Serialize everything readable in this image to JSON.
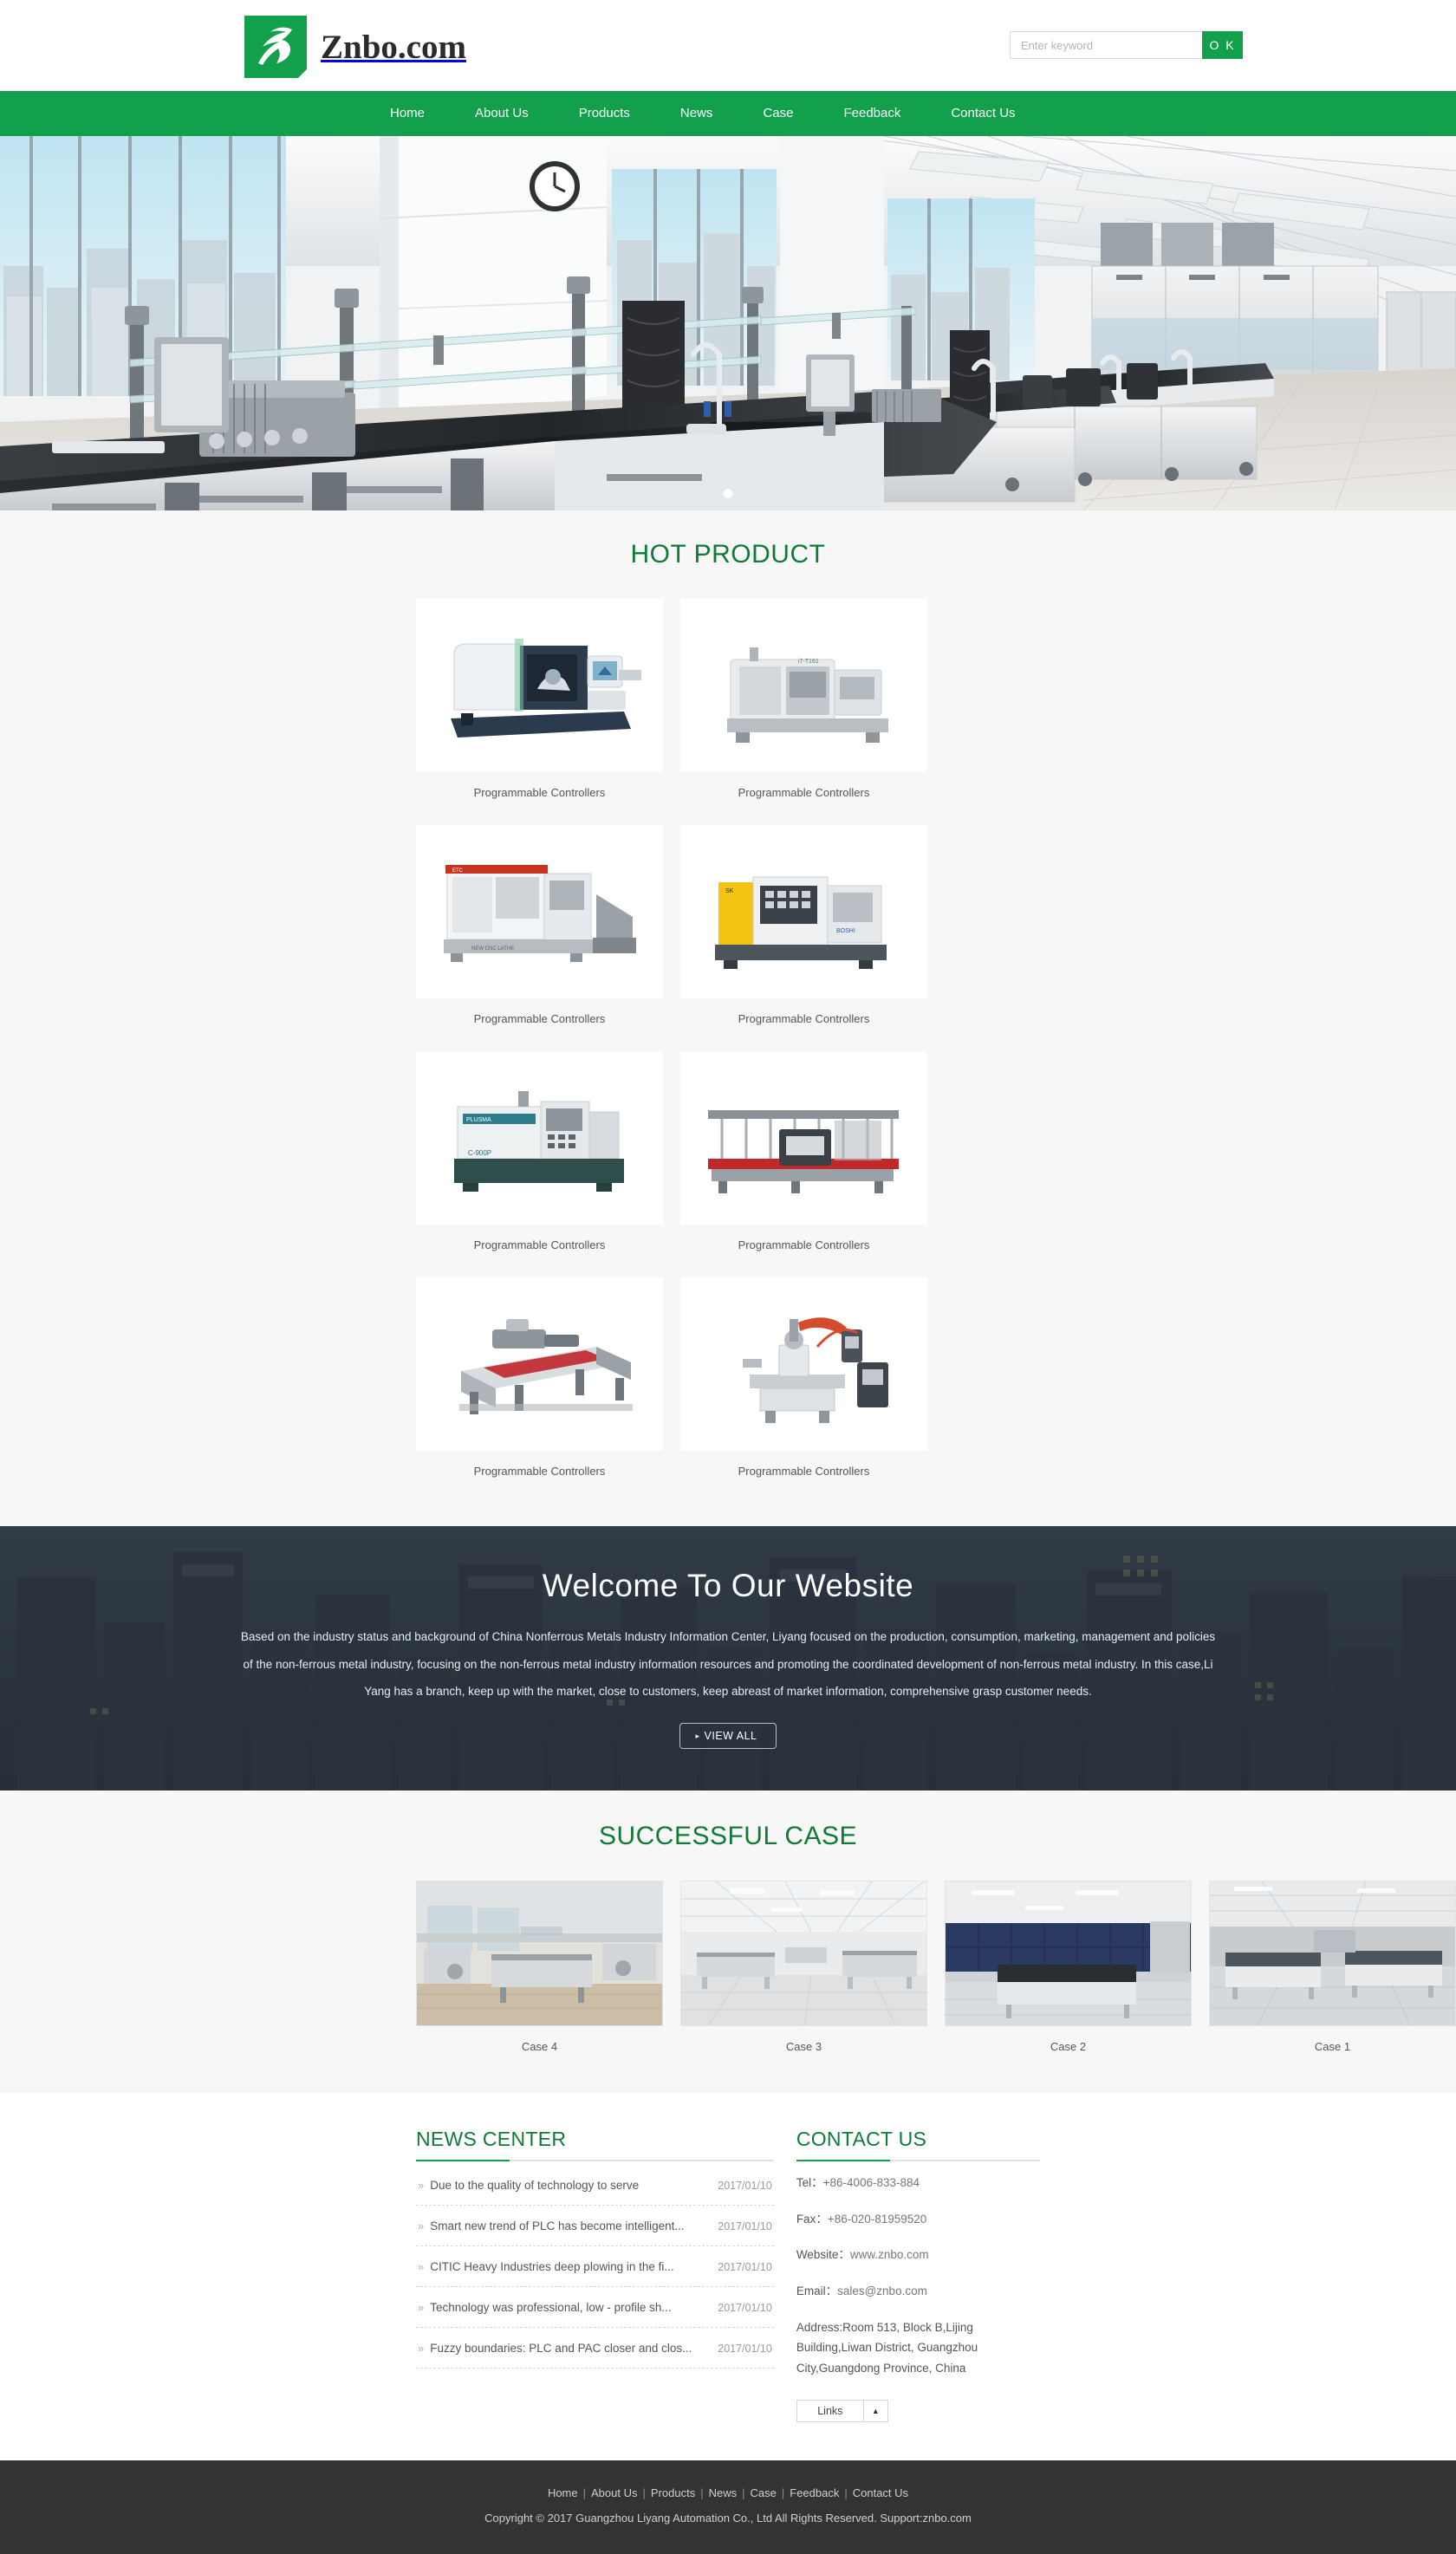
{
  "header": {
    "logo_text": "Znbo.com",
    "logo_icon": "znbo-bird-logo-icon",
    "search": {
      "placeholder": "Enter keyword",
      "value": "",
      "button_label": "O K"
    }
  },
  "nav": {
    "items": [
      {
        "label": "Home"
      },
      {
        "label": "About Us"
      },
      {
        "label": "Products"
      },
      {
        "label": "News"
      },
      {
        "label": "Case"
      },
      {
        "label": "Feedback"
      },
      {
        "label": "Contact Us"
      }
    ]
  },
  "hero": {
    "alt": "laboratory interior with white benches and black countertops",
    "slide_count": 1
  },
  "hot_product": {
    "title": "HOT PRODUCT",
    "items": [
      {
        "label": "Programmable Controllers",
        "image": "cnc-lathe-dark-blue"
      },
      {
        "label": "Programmable Controllers",
        "image": "cnc-milling-grey"
      },
      {
        "label": "Programmable Controllers",
        "image": "cnc-lathe-etc-white"
      },
      {
        "label": "Programmable Controllers",
        "image": "cnc-lathe-yellow-skg"
      },
      {
        "label": "Programmable Controllers",
        "image": "cnc-lathe-teal-c900p"
      },
      {
        "label": "Programmable Controllers",
        "image": "glass-edging-machine"
      },
      {
        "label": "Programmable Controllers",
        "image": "glass-cutting-table"
      },
      {
        "label": "Programmable Controllers",
        "image": "robotic-arm-machine"
      }
    ]
  },
  "welcome": {
    "title": "Welcome To Our Website",
    "body": "Based on the industry status and background of China Nonferrous Metals Industry Information Center, Liyang focused on the production, consumption, marketing, management and policies of the non-ferrous metal industry, focusing on the non-ferrous metal industry information resources and promoting the coordinated development of non-ferrous metal industry. In this case,Li Yang has a branch, keep up with the market, close to customers, keep abreast of market information, comprehensive grasp customer needs.",
    "view_all_label": "VIEW ALL",
    "view_all_marker": "▸"
  },
  "successful_case": {
    "title": "SUCCESSFUL CASE",
    "items": [
      {
        "label": "Case 4",
        "image": "lab-room-wood-floor"
      },
      {
        "label": "Case 3",
        "image": "lab-open-hall-white"
      },
      {
        "label": "Case 2",
        "image": "lab-blue-cabinets"
      },
      {
        "label": "Case 1",
        "image": "lab-long-benches-grey"
      }
    ]
  },
  "news_center": {
    "title": "NEWS CENTER",
    "bullet": "»",
    "items": [
      {
        "title": "Due to the quality of technology to serve",
        "date": "2017/01/10"
      },
      {
        "title": "Smart new trend of PLC has become intelligent...",
        "date": "2017/01/10"
      },
      {
        "title": "CITIC Heavy Industries deep plowing in the fi...",
        "date": "2017/01/10"
      },
      {
        "title": "Technology was professional, low - profile sh...",
        "date": "2017/01/10"
      },
      {
        "title": "Fuzzy boundaries: PLC and PAC closer and clos...",
        "date": "2017/01/10"
      }
    ]
  },
  "contact_us": {
    "title": "CONTACT US",
    "tel_label": "Tel：",
    "tel_value": "+86-4006-833-884",
    "fax_label": "Fax：",
    "fax_value": "+86-020-81959520",
    "website_label": "Website：",
    "website_value": "www.znbo.com",
    "email_label": "Email：",
    "email_value": "sales@znbo.com",
    "address": "Address:Room 513, Block B,Lijing Building,Liwan District, Guangzhou City,Guangdong Province, China",
    "links_label": "Links",
    "links_caret": "▲"
  },
  "footer": {
    "nav": [
      {
        "label": "Home"
      },
      {
        "label": "About Us"
      },
      {
        "label": "Products"
      },
      {
        "label": "News"
      },
      {
        "label": "Case"
      },
      {
        "label": "Feedback"
      },
      {
        "label": "Contact Us"
      }
    ],
    "separator": "|",
    "copyright": "Copyright © 2017 Guangzhou Liyang Automation Co., Ltd All Rights Reserved.  Support:znbo.com"
  },
  "colors": {
    "brand_green": "#12a04c",
    "title_green": "#117a38",
    "footer_bg": "#333333",
    "section_bg": "#f7f7f7"
  }
}
